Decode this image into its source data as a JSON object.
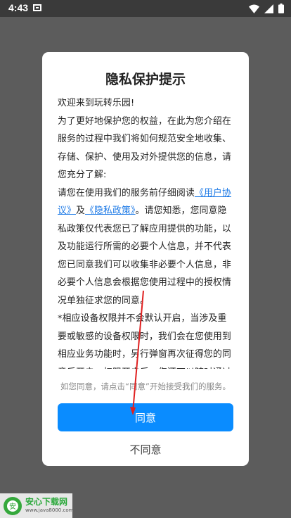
{
  "status": {
    "time": "4:43"
  },
  "dialog": {
    "title": "隐私保护提示",
    "p1": "欢迎来到玩转乐园!",
    "p2": "为了更好地保护您的权益，在此为您介绍在服务的过程中我们将如何规范安全地收集、存储、保护、使用及对外提供您的信息，请您充分了解:",
    "p3_before": "请您在使用我们的服务前仔细阅读",
    "link_user": "《用户协议》",
    "p3_and": "及",
    "link_privacy": "《隐私政策》",
    "p3_after": "。请您知悉，您同意隐私政策仅代表您已了解应用提供的功能，以及功能运行所需的必要个人信息，并不代表您已同意我们可以收集非必要个人信息，非必要个人信息会根据您使用过程中的授权情况单独征求您的同意。",
    "p4": "*相应设备权限并不会默认开启，当涉及重要或敏感的设备权限时，我们会在您使用到相应业务功能时，另行弹窗再次征得您的同意后开启；权限开启后，您还可以随时通过设备设置关闭权限；你不同意开启权限，将不会影响其",
    "agree_hint": "如您同意，请点击“同意”开始接受我们的服务。",
    "agree_label": "同意",
    "disagree_label": "不同意"
  },
  "watermark": {
    "name": "安心下载网",
    "url": "www.java8000.com",
    "logo_text": "安 "
  }
}
